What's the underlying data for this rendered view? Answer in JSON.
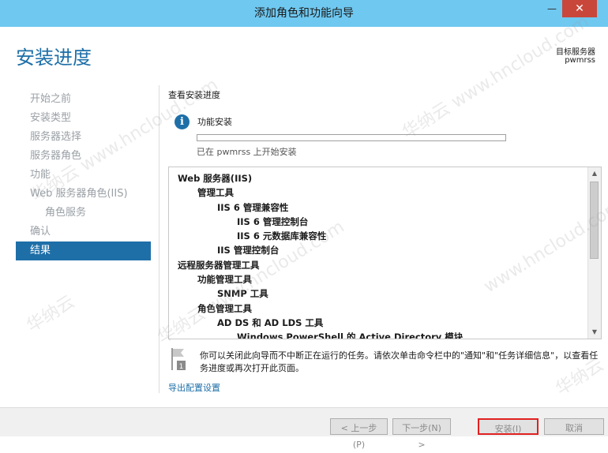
{
  "window": {
    "title": "添加角色和功能向导",
    "minimize_glyph": "—",
    "close_glyph": "✕"
  },
  "header": {
    "page_title": "安装进度",
    "target_label": "目标服务器",
    "target_value": "pwmrss"
  },
  "nav": {
    "items": [
      {
        "label": "开始之前"
      },
      {
        "label": "安装类型"
      },
      {
        "label": "服务器选择"
      },
      {
        "label": "服务器角色"
      },
      {
        "label": "功能"
      },
      {
        "label": "Web 服务器角色(IIS)"
      },
      {
        "label": "角色服务"
      },
      {
        "label": "确认"
      },
      {
        "label": "结果"
      }
    ]
  },
  "main": {
    "section_heading": "查看安装进度",
    "feature_label": "功能安装",
    "progress": 0.0,
    "status": "已在 pwmrss 上开始安装",
    "results": [
      {
        "text": "Web 服务器(IIS)"
      },
      {
        "text": "管理工具"
      },
      {
        "text": "IIS 6 管理兼容性"
      },
      {
        "text": "IIS 6 管理控制台"
      },
      {
        "text": "IIS 6 元数据库兼容性"
      },
      {
        "text": "IIS 管理控制台"
      },
      {
        "text": "远程服务器管理工具"
      },
      {
        "text": "功能管理工具"
      },
      {
        "text": "SNMP 工具"
      },
      {
        "text": "角色管理工具"
      },
      {
        "text": "AD DS 和 AD LDS 工具"
      },
      {
        "text": "Windows PowerShell 的 Active Directory 模块"
      }
    ],
    "note": "你可以关闭此向导而不中断正在运行的任务。请依次单击命令栏中的\"通知\"和\"任务详细信息\"，以查看任务进度或再次打开此页面。",
    "export_link": "导出配置设置"
  },
  "footer": {
    "prev_label": "< 上一步(P)",
    "next_label": "下一步(N) >",
    "install_label": "安装(I)",
    "cancel_label": "取消"
  },
  "watermark": {
    "text_1": "华纳云 www.hncloud.com",
    "text_2": "www.hncloud.com",
    "text_3": "华纳云"
  },
  "colors": {
    "titlebar": "#6fc8f0",
    "accent": "#1e6fa8",
    "close_button": "#c9473a",
    "install_highlight": "#e02020"
  }
}
